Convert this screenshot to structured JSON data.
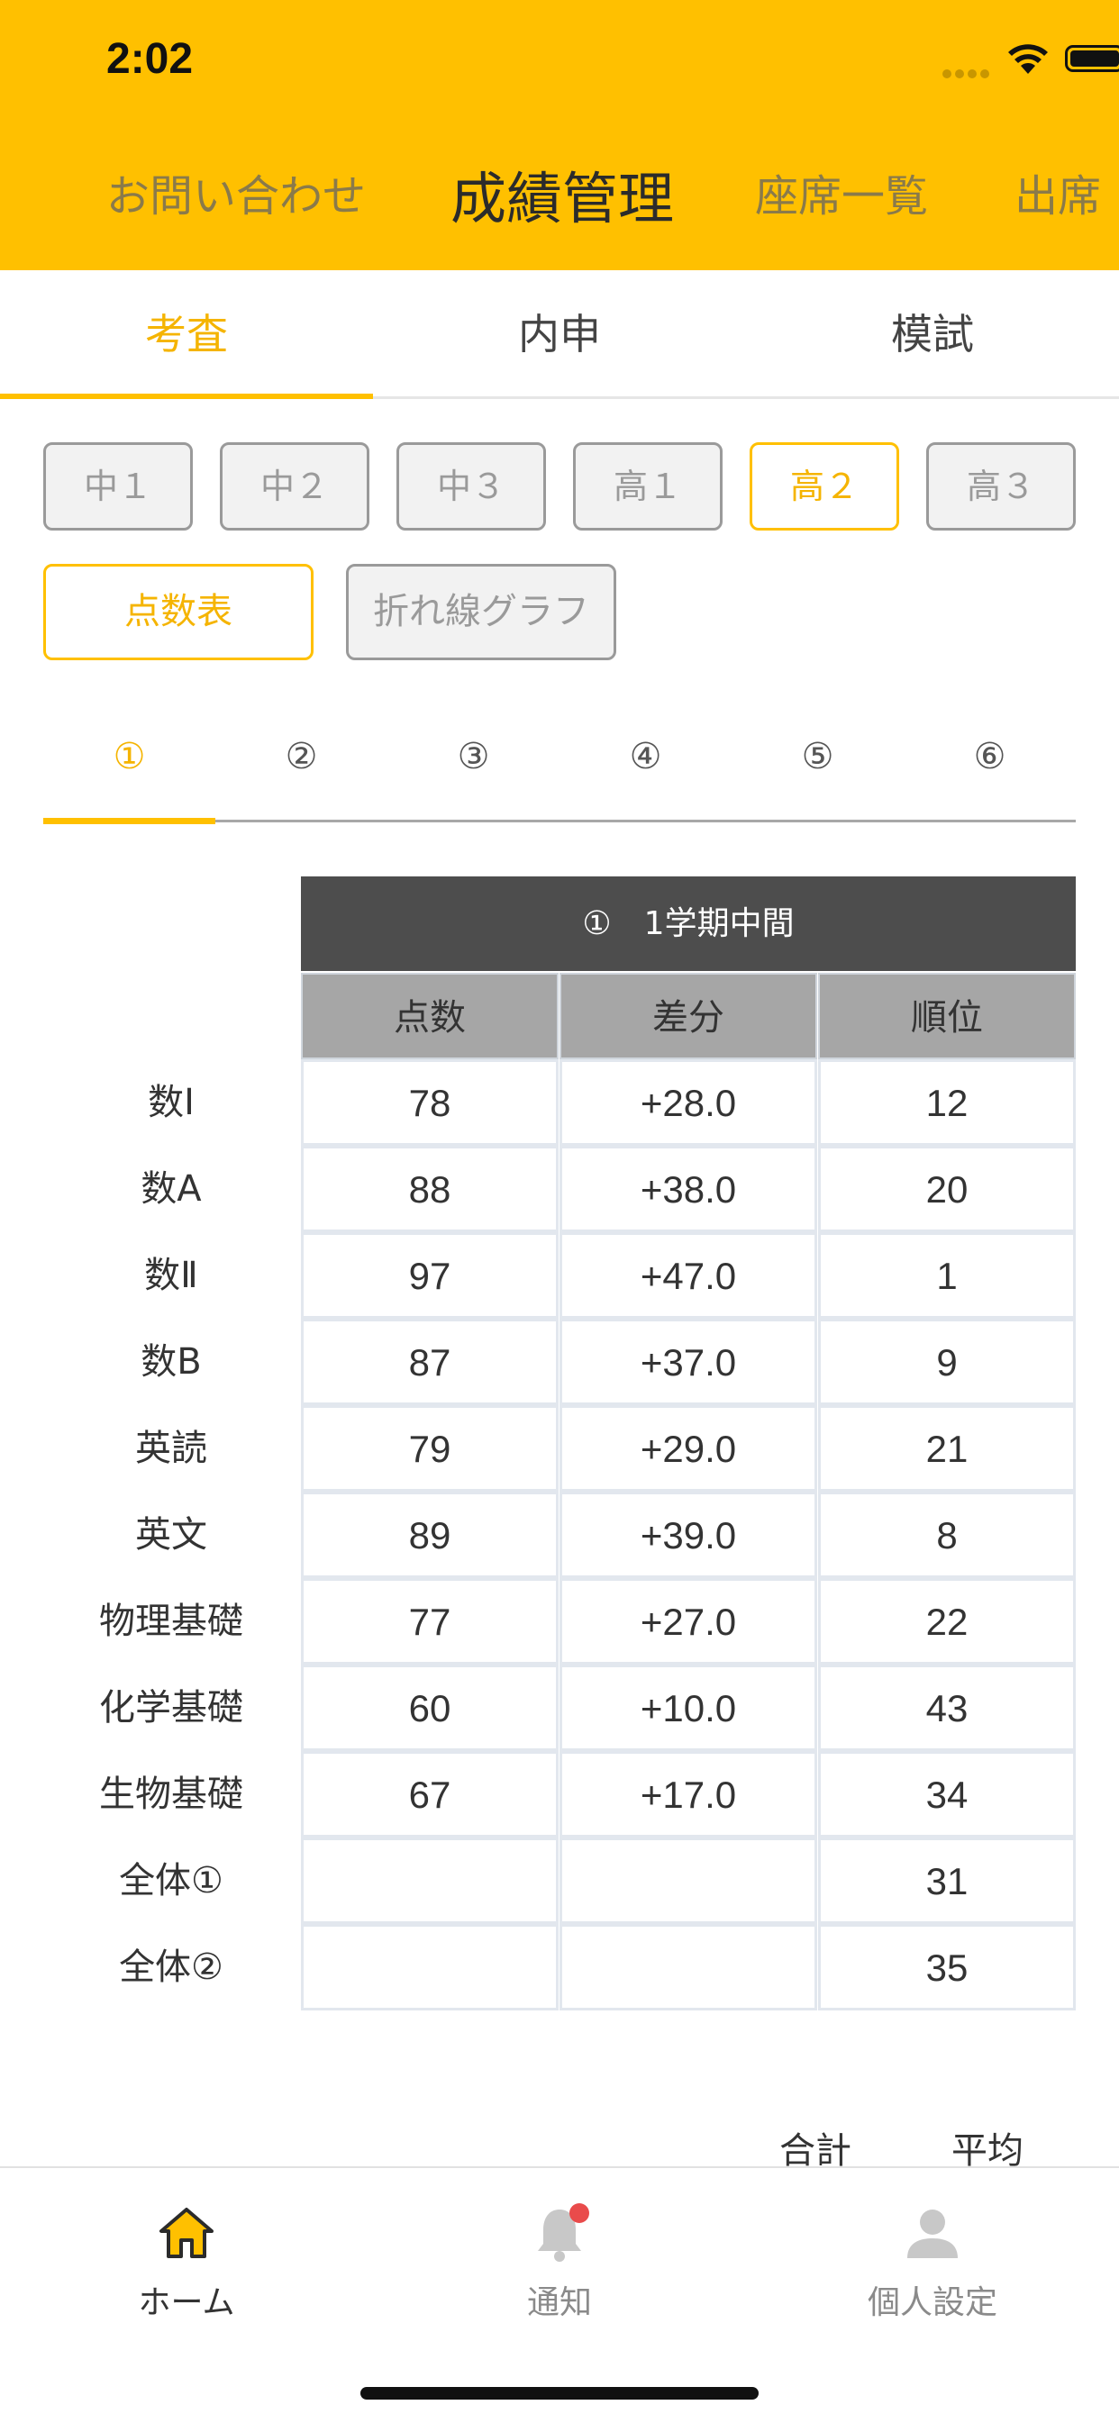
{
  "status_bar": {
    "time": "2:02"
  },
  "nav": {
    "tabs": [
      {
        "label": "お問い合わせ",
        "active": false
      },
      {
        "label": "成績管理",
        "active": true
      },
      {
        "label": "座席一覧",
        "active": false
      },
      {
        "label": "出席",
        "active": false
      }
    ]
  },
  "segment": {
    "tabs": [
      {
        "label": "考査",
        "active": true
      },
      {
        "label": "内申",
        "active": false
      },
      {
        "label": "模試",
        "active": false
      }
    ]
  },
  "grades": [
    {
      "label": "中１",
      "active": false
    },
    {
      "label": "中２",
      "active": false
    },
    {
      "label": "中３",
      "active": false
    },
    {
      "label": "高１",
      "active": false
    },
    {
      "label": "高２",
      "active": true
    },
    {
      "label": "高３",
      "active": false
    }
  ],
  "view_modes": [
    {
      "label": "点数表",
      "active": true
    },
    {
      "label": "折れ線グラフ",
      "active": false
    }
  ],
  "exam_tabs": [
    "①",
    "②",
    "③",
    "④",
    "⑤",
    "⑥"
  ],
  "table": {
    "title": "①　1学期中間",
    "headers": [
      "点数",
      "差分",
      "順位"
    ],
    "rows": [
      {
        "subject": "数Ⅰ",
        "score": "78",
        "diff": "+28.0",
        "rank": "12"
      },
      {
        "subject": "数A",
        "score": "88",
        "diff": "+38.0",
        "rank": "20"
      },
      {
        "subject": "数Ⅱ",
        "score": "97",
        "diff": "+47.0",
        "rank": "1"
      },
      {
        "subject": "数B",
        "score": "87",
        "diff": "+37.0",
        "rank": "9"
      },
      {
        "subject": "英読",
        "score": "79",
        "diff": "+29.0",
        "rank": "21"
      },
      {
        "subject": "英文",
        "score": "89",
        "diff": "+39.0",
        "rank": "8"
      },
      {
        "subject": "物理基礎",
        "score": "77",
        "diff": "+27.0",
        "rank": "22"
      },
      {
        "subject": "化学基礎",
        "score": "60",
        "diff": "+10.0",
        "rank": "43"
      },
      {
        "subject": "生物基礎",
        "score": "67",
        "diff": "+17.0",
        "rank": "34"
      },
      {
        "subject": "全体①",
        "score": "",
        "diff": "",
        "rank": "31"
      },
      {
        "subject": "全体②",
        "score": "",
        "diff": "",
        "rank": "35"
      }
    ]
  },
  "summary_labels": {
    "total": "合計",
    "average": "平均"
  },
  "tabbar": {
    "items": [
      {
        "label": "ホーム",
        "icon": "home-icon",
        "active": true
      },
      {
        "label": "通知",
        "icon": "bell-icon",
        "active": false
      },
      {
        "label": "個人設定",
        "icon": "person-icon",
        "active": false
      }
    ]
  },
  "colors": {
    "accent": "#FFC000",
    "accent_text": "#F5B400",
    "table_title_bg": "#4d4d4d",
    "table_header_bg": "#a6a6a6",
    "badge": "#E94B4B"
  }
}
